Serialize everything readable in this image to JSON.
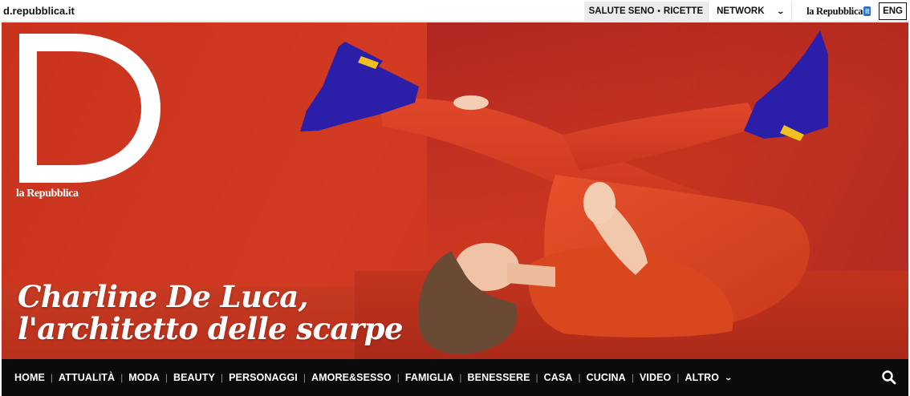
{
  "topbar": {
    "site_domain": "d.repubblica.it",
    "links": [
      "SALUTE SENO",
      "RICETTE"
    ],
    "link_separator": "•",
    "network_label": "NETWORK",
    "repubblica_logo": "la Repubblica",
    "repubblica_logo_suffix": "it",
    "language_button": "ENG"
  },
  "hero": {
    "brand_letter": "D",
    "brand_tagline": "la Repubblica",
    "headline_line1": "Charline De Luca,",
    "headline_line2": "l'architetto delle scarpe"
  },
  "nav": {
    "items": [
      "HOME",
      "ATTUALITÀ",
      "MODA",
      "BEAUTY",
      "PERSONAGGI",
      "AMORE&SESSO",
      "FAMIGLIA",
      "BENESSERE",
      "CASA",
      "CUCINA",
      "VIDEO",
      "ALTRO"
    ]
  },
  "colors": {
    "hero_red": "#d23b22",
    "nav_background": "#0b0b0b",
    "shoe_blue": "#2b1ea8"
  }
}
